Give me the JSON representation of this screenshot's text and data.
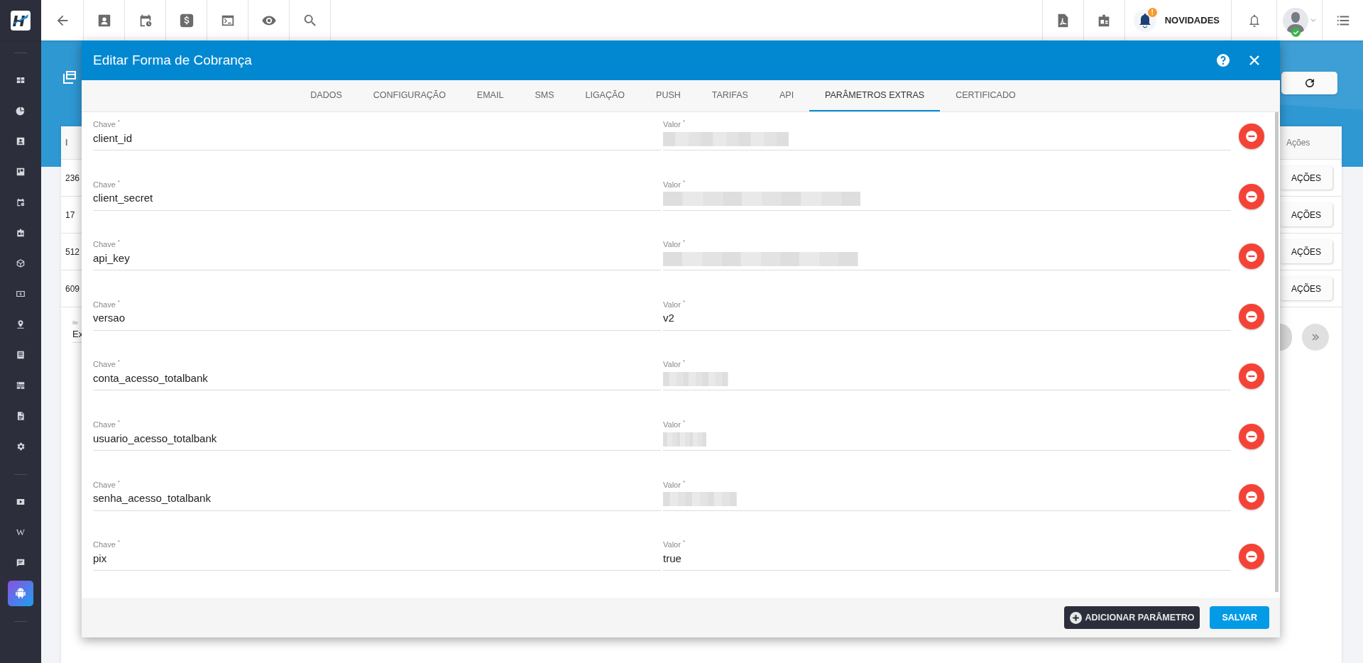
{
  "topbar": {
    "left_tools": [
      {
        "kind": "back"
      },
      {
        "kind": "contact"
      },
      {
        "kind": "calendar"
      },
      {
        "kind": "dollar"
      },
      {
        "kind": "terminal"
      },
      {
        "kind": "eye"
      },
      {
        "kind": "search"
      }
    ],
    "news": {
      "label": "NOVIDADES",
      "badge": "!"
    },
    "user": {
      "online": true
    }
  },
  "sidebar": {
    "items": [
      {
        "kind": "grid",
        "selected": false
      },
      {
        "kind": "pie",
        "selected": false
      },
      {
        "kind": "contact",
        "selected": false
      },
      {
        "kind": "board",
        "selected": false
      },
      {
        "kind": "calendar",
        "selected": false
      },
      {
        "kind": "badge",
        "selected": false
      },
      {
        "kind": "box",
        "selected": false
      },
      {
        "kind": "money",
        "selected": false
      },
      {
        "kind": "pin",
        "selected": false
      },
      {
        "kind": "list",
        "selected": false
      },
      {
        "kind": "server",
        "selected": false
      },
      {
        "kind": "doc",
        "selected": false
      },
      {
        "kind": "gear",
        "selected": false
      },
      {
        "kind": "divider"
      },
      {
        "kind": "play",
        "selected": false
      },
      {
        "kind": "glyph",
        "glyph": "W",
        "selected": false
      },
      {
        "kind": "chat",
        "selected": false
      },
      {
        "kind": "android",
        "selected": true
      }
    ]
  },
  "background_table": {
    "header_left": "I",
    "header_right": "Ações",
    "rows": [
      {
        "id": "236",
        "action": "AÇÕES"
      },
      {
        "id": "17",
        "action": "AÇÕES"
      },
      {
        "id": "512",
        "action": "AÇÕES"
      },
      {
        "id": "609",
        "action": "AÇÕES"
      }
    ],
    "items_label": "Ite",
    "items_value": "Ex"
  },
  "modal": {
    "title": "Editar Forma de Cobrança",
    "tabs": [
      {
        "label": "DADOS",
        "selected": false
      },
      {
        "label": "CONFIGURAÇÃO",
        "selected": false
      },
      {
        "label": "EMAIL",
        "selected": false
      },
      {
        "label": "SMS",
        "selected": false
      },
      {
        "label": "LIGAÇÃO",
        "selected": false
      },
      {
        "label": "PUSH",
        "selected": false
      },
      {
        "label": "TARIFAS",
        "selected": false
      },
      {
        "label": "API",
        "selected": false
      },
      {
        "label": "PARÂMETROS EXTRAS",
        "selected": true
      },
      {
        "label": "CERTIFICADO",
        "selected": false
      }
    ],
    "params": [
      {
        "key_label": "Chave $^{*}$",
        "key": "client_id",
        "value_label": "Valor $^{*}$",
        "blurred": true
      },
      {
        "key_label": "Chave $^{*}$",
        "key": "client_secret",
        "value_label": "Valor $^{*}$",
        "blurred": true
      },
      {
        "key_label": "Chave $^{*}$",
        "key": "api_key",
        "value_label": "Valor $^{*}$",
        "blurred": true
      },
      {
        "key_label": "Chave $^{*}$",
        "key": "versao",
        "value_label": "Valor $^{*}$",
        "blurred": false,
        "value": "v2"
      },
      {
        "key_label": "Chave $^{*}$",
        "key": "conta_acesso_totalbank",
        "value_label": "Valor $^{*}$",
        "blurred": true
      },
      {
        "key_label": "Chave $^{*}$",
        "key": "usuario_acesso_totalbank",
        "value_label": "Valor $^{*}$",
        "blurred": true
      },
      {
        "key_label": "Chave $^{*}$",
        "key": "senha_acesso_totalbank",
        "value_label": "Valor $^{*}$",
        "blurred": true
      },
      {
        "key_label": "Chave $^{*}$",
        "key": "pix",
        "value_label": "Valor $^{*}$",
        "blurred": false,
        "value": "true"
      }
    ],
    "add_button": "ADICIONAR PARÂMETRO",
    "save_button": "SALVAR"
  }
}
